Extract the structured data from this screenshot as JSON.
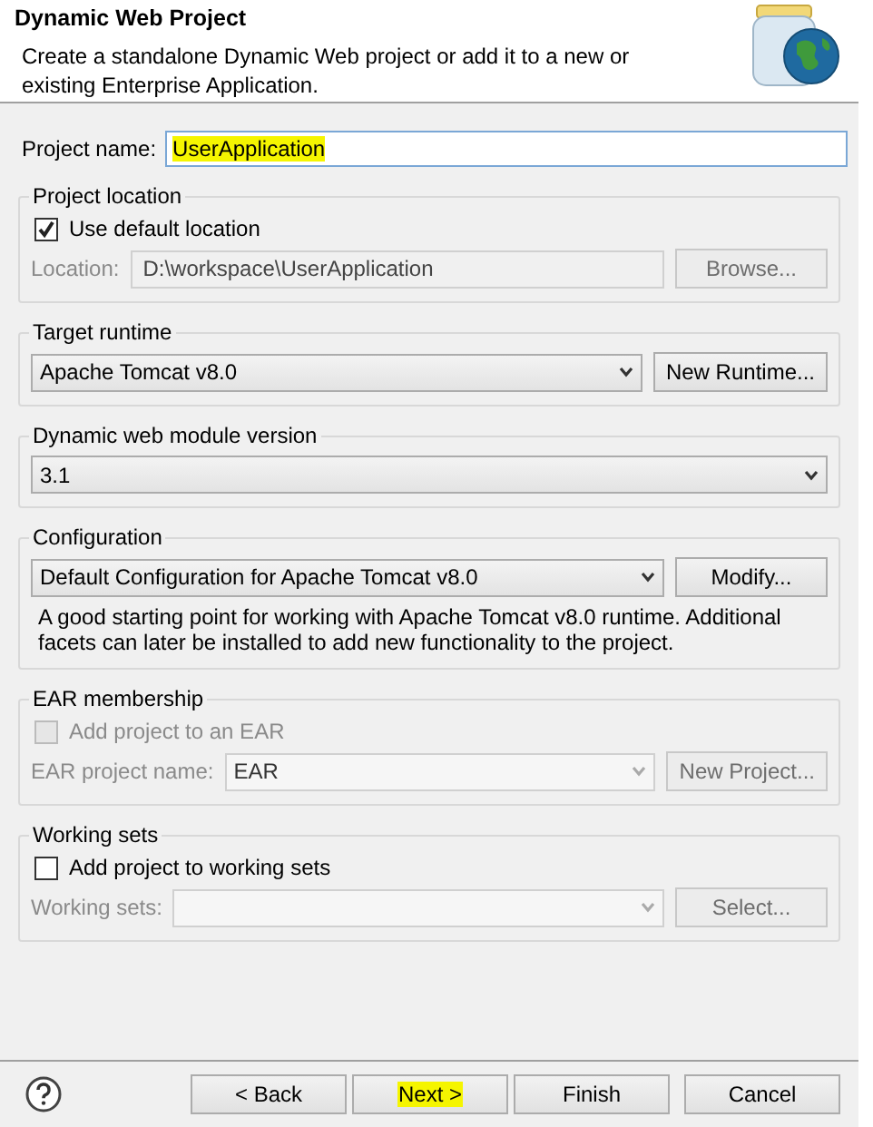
{
  "window": {
    "title": "Dynamic Web Project",
    "description": "Create a standalone Dynamic Web project or add it to a new or existing Enterprise Application."
  },
  "project_name": {
    "label": "Project name:",
    "value": "UserApplication",
    "highlighted": true
  },
  "groups": [
    {
      "title": "Project location",
      "rows": [
        {
          "kind": "checkbox",
          "label": "Use default location",
          "checked": true,
          "disabled": false
        },
        {
          "kind": "field",
          "label": "Location:",
          "value": "D:\\workspace\\UserApplication",
          "disabled": true,
          "button": {
            "label": "Browse...",
            "disabled": true
          }
        }
      ]
    },
    {
      "title": "Target runtime",
      "rows": [
        {
          "kind": "combo",
          "value": "Apache Tomcat v8.0",
          "disabled": false,
          "button": {
            "label": "New Runtime...",
            "disabled": false
          }
        }
      ]
    },
    {
      "title": "Dynamic web module version",
      "rows": [
        {
          "kind": "combo",
          "value": "3.1",
          "disabled": false
        }
      ]
    },
    {
      "title": "Configuration",
      "rows": [
        {
          "kind": "combo",
          "value": "Default Configuration for Apache Tomcat v8.0",
          "disabled": false,
          "button": {
            "label": "Modify...",
            "disabled": false
          }
        },
        {
          "kind": "note",
          "text": "A good starting point for working with Apache Tomcat v8.0 runtime. Additional facets can later be installed to add new functionality to the project."
        }
      ]
    },
    {
      "title": "EAR membership",
      "rows": [
        {
          "kind": "checkbox",
          "label": "Add project to an EAR",
          "checked": false,
          "disabled": true
        },
        {
          "kind": "combo",
          "label": "EAR project name:",
          "value": "EAR",
          "disabled": true,
          "button": {
            "label": "New Project...",
            "disabled": true
          }
        }
      ]
    },
    {
      "title": "Working sets",
      "rows": [
        {
          "kind": "checkbox",
          "label": "Add project to working sets",
          "checked": false,
          "disabled": false
        },
        {
          "kind": "combo",
          "label": "Working sets:",
          "disabled": true,
          "button": {
            "label": "Select...",
            "disabled": true
          }
        }
      ]
    }
  ],
  "buttons": [
    {
      "label": "< Back",
      "disabled": false,
      "highlighted": false
    },
    {
      "label": "Next >",
      "disabled": false,
      "highlighted": true
    },
    {
      "label": "Finish",
      "disabled": false,
      "highlighted": false
    },
    {
      "label": "Cancel",
      "disabled": false,
      "highlighted": false
    }
  ]
}
